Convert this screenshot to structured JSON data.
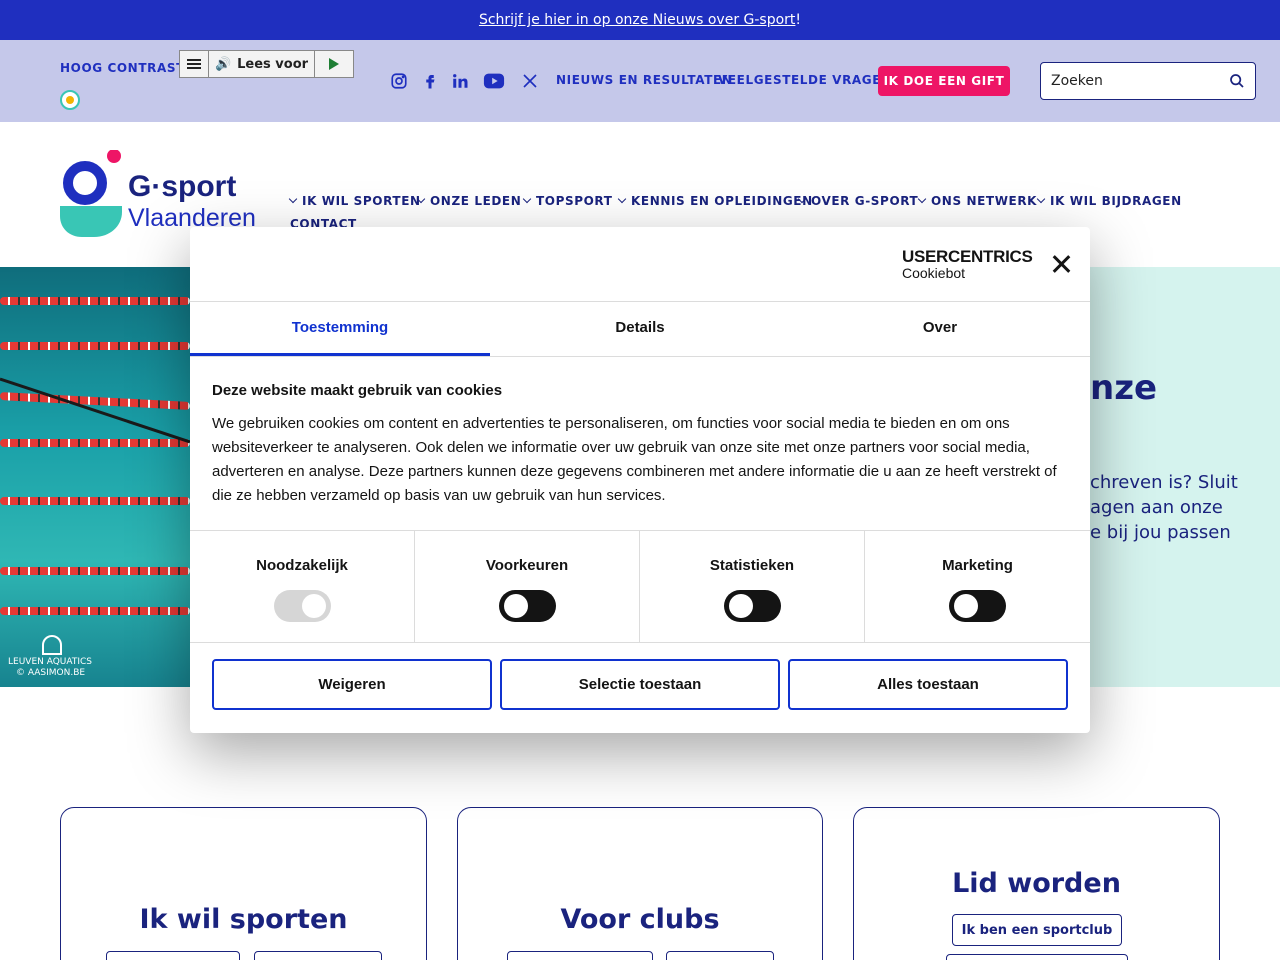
{
  "announcement": {
    "link_text": "Schrijf je hier in op onze Nieuws over G-sport",
    "suffix": "!"
  },
  "utility": {
    "hoog_contrast": "HOOG CONTRAST",
    "reader_label": "Lees voor",
    "social": [
      "instagram-icon",
      "facebook-icon",
      "linkedin-icon",
      "youtube-icon",
      "x-icon"
    ],
    "links": [
      "NIEUWS EN RESULTATEN",
      "VEELGESTELDE VRAGEN"
    ],
    "gift": "IK DOE EEN GIFT",
    "search_placeholder": "Zoeken"
  },
  "logo": {
    "line1": "G·sport",
    "line2": "Vlaanderen"
  },
  "nav": [
    "IK WIL SPORTEN",
    "ONZE LEDEN",
    "TOPSPORT",
    "KENNIS EN OPLEIDINGEN",
    "OVER G-SPORT",
    "ONS NETWERK",
    "IK WIL BIJDRAGEN",
    "CONTACT"
  ],
  "hero": {
    "title_fragment": "nze",
    "text_lines": [
      "chreven is? Sluit",
      "agen aan onze",
      "e bij jou passen"
    ],
    "credit_line1": "LEUVEN AQUATICS",
    "credit_line2": "© AASIMON.BE"
  },
  "cards": [
    {
      "title": "Ik wil sporten"
    },
    {
      "title": "Voor clubs"
    },
    {
      "title": "Lid worden",
      "button": "Ik ben een sportclub"
    }
  ],
  "cookie": {
    "brand_line1": "USERCENTRICS",
    "brand_line2": "Cookiebot",
    "tabs": [
      "Toestemming",
      "Details",
      "Over"
    ],
    "heading": "Deze website maakt gebruik van cookies",
    "body": "We gebruiken cookies om content en advertenties te personaliseren, om functies voor social media te bieden en om ons websiteverkeer te analyseren. Ook delen we informatie over uw gebruik van onze site met onze partners voor social media, adverteren en analyse. Deze partners kunnen deze gegevens combineren met andere informatie die u aan ze heeft verstrekt of die ze hebben verzameld op basis van uw gebruik van hun services.",
    "categories": [
      "Noodzakelijk",
      "Voorkeuren",
      "Statistieken",
      "Marketing"
    ],
    "buttons": [
      "Weigeren",
      "Selectie toestaan",
      "Alles toestaan"
    ]
  },
  "colors": {
    "brand_blue": "#1f2fbf",
    "navy": "#1a237e",
    "pink": "#ee1566",
    "teal": "#39c6b5",
    "cookie_accent": "#1032cf"
  }
}
